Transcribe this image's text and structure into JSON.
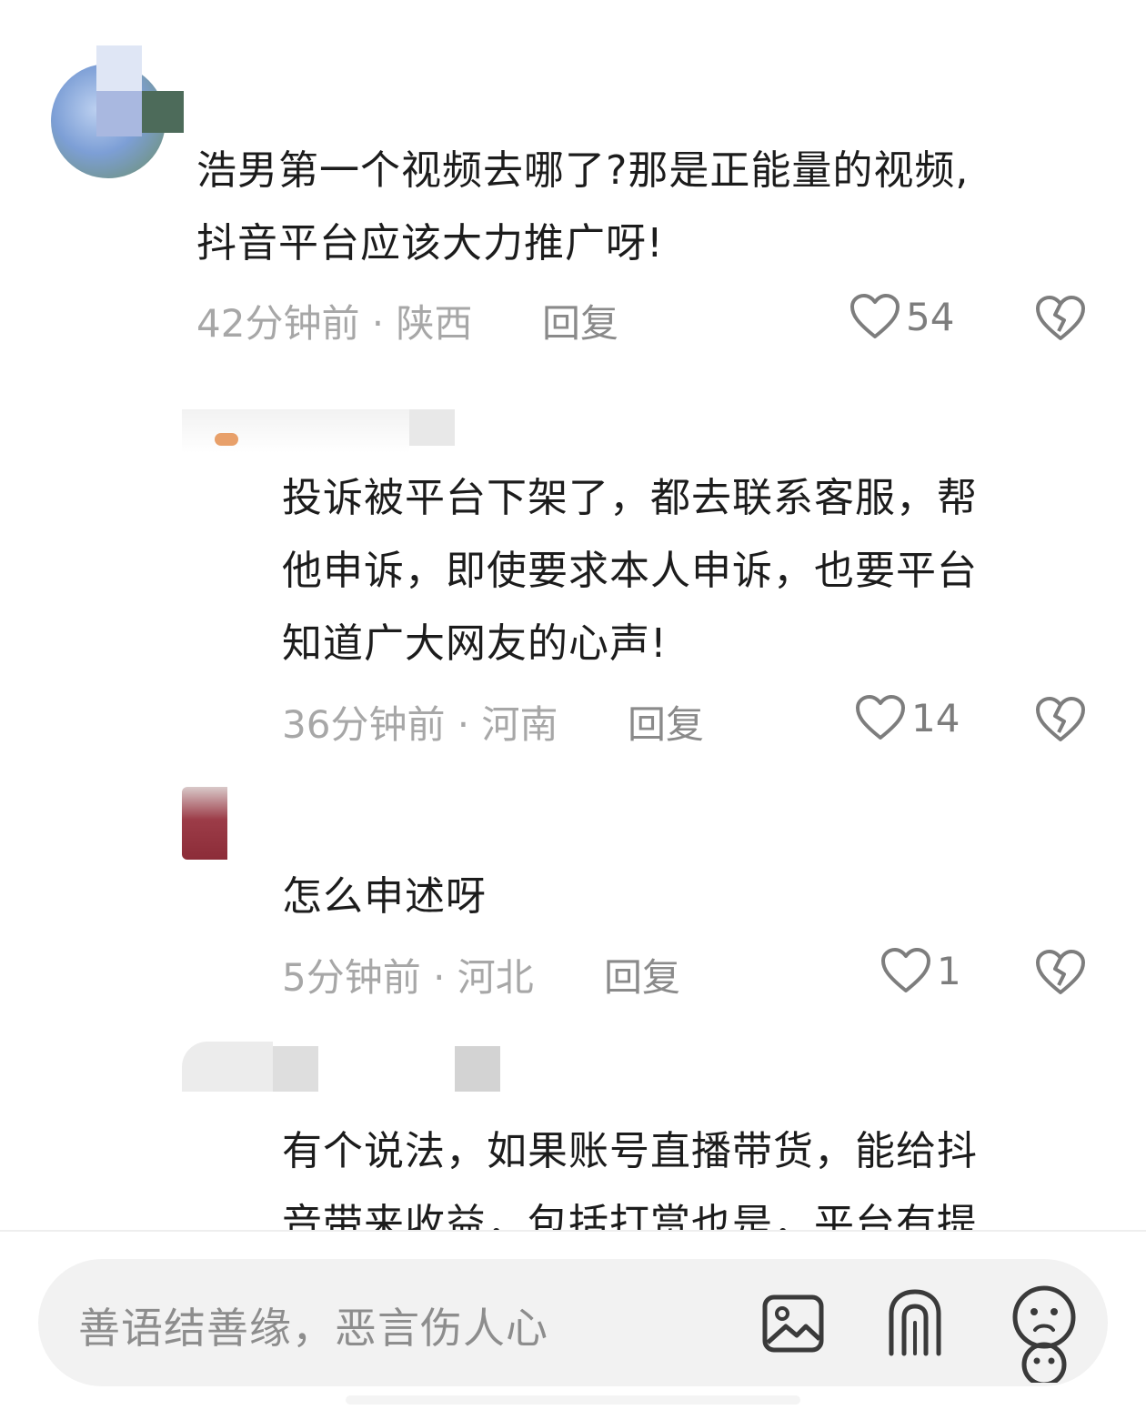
{
  "comments": [
    {
      "text_lines": [
        "浩男第一个视频去哪了?那是正能量的视频,",
        "抖音平台应该大力推广呀!"
      ],
      "time": "42分钟前",
      "location": "陕西",
      "reply_label": "回复",
      "likes": "54"
    },
    {
      "text_lines": [
        "投诉被平台下架了，都去联系客服，帮",
        "他申诉，即使要求本人申诉，也要平台",
        "知道广大网友的心声!"
      ],
      "time": "36分钟前",
      "location": "河南",
      "reply_label": "回复",
      "likes": "14"
    },
    {
      "text_lines": [
        "怎么申述呀"
      ],
      "time": "5分钟前",
      "location": "河北",
      "reply_label": "回复",
      "likes": "1"
    },
    {
      "text_lines": [
        "有个说法，如果账号直播带货，能给抖",
        "音带来收益，包括打赏也是，平台有提"
      ]
    }
  ],
  "meta_separator": " · ",
  "input": {
    "placeholder": "善语结善缘，恶言伤人心"
  },
  "icons": {
    "like": "heart-outline-icon",
    "dislike": "broken-heart-icon",
    "image": "image-icon",
    "at": "at-mention-icon",
    "emoji": "emoji-icon"
  }
}
